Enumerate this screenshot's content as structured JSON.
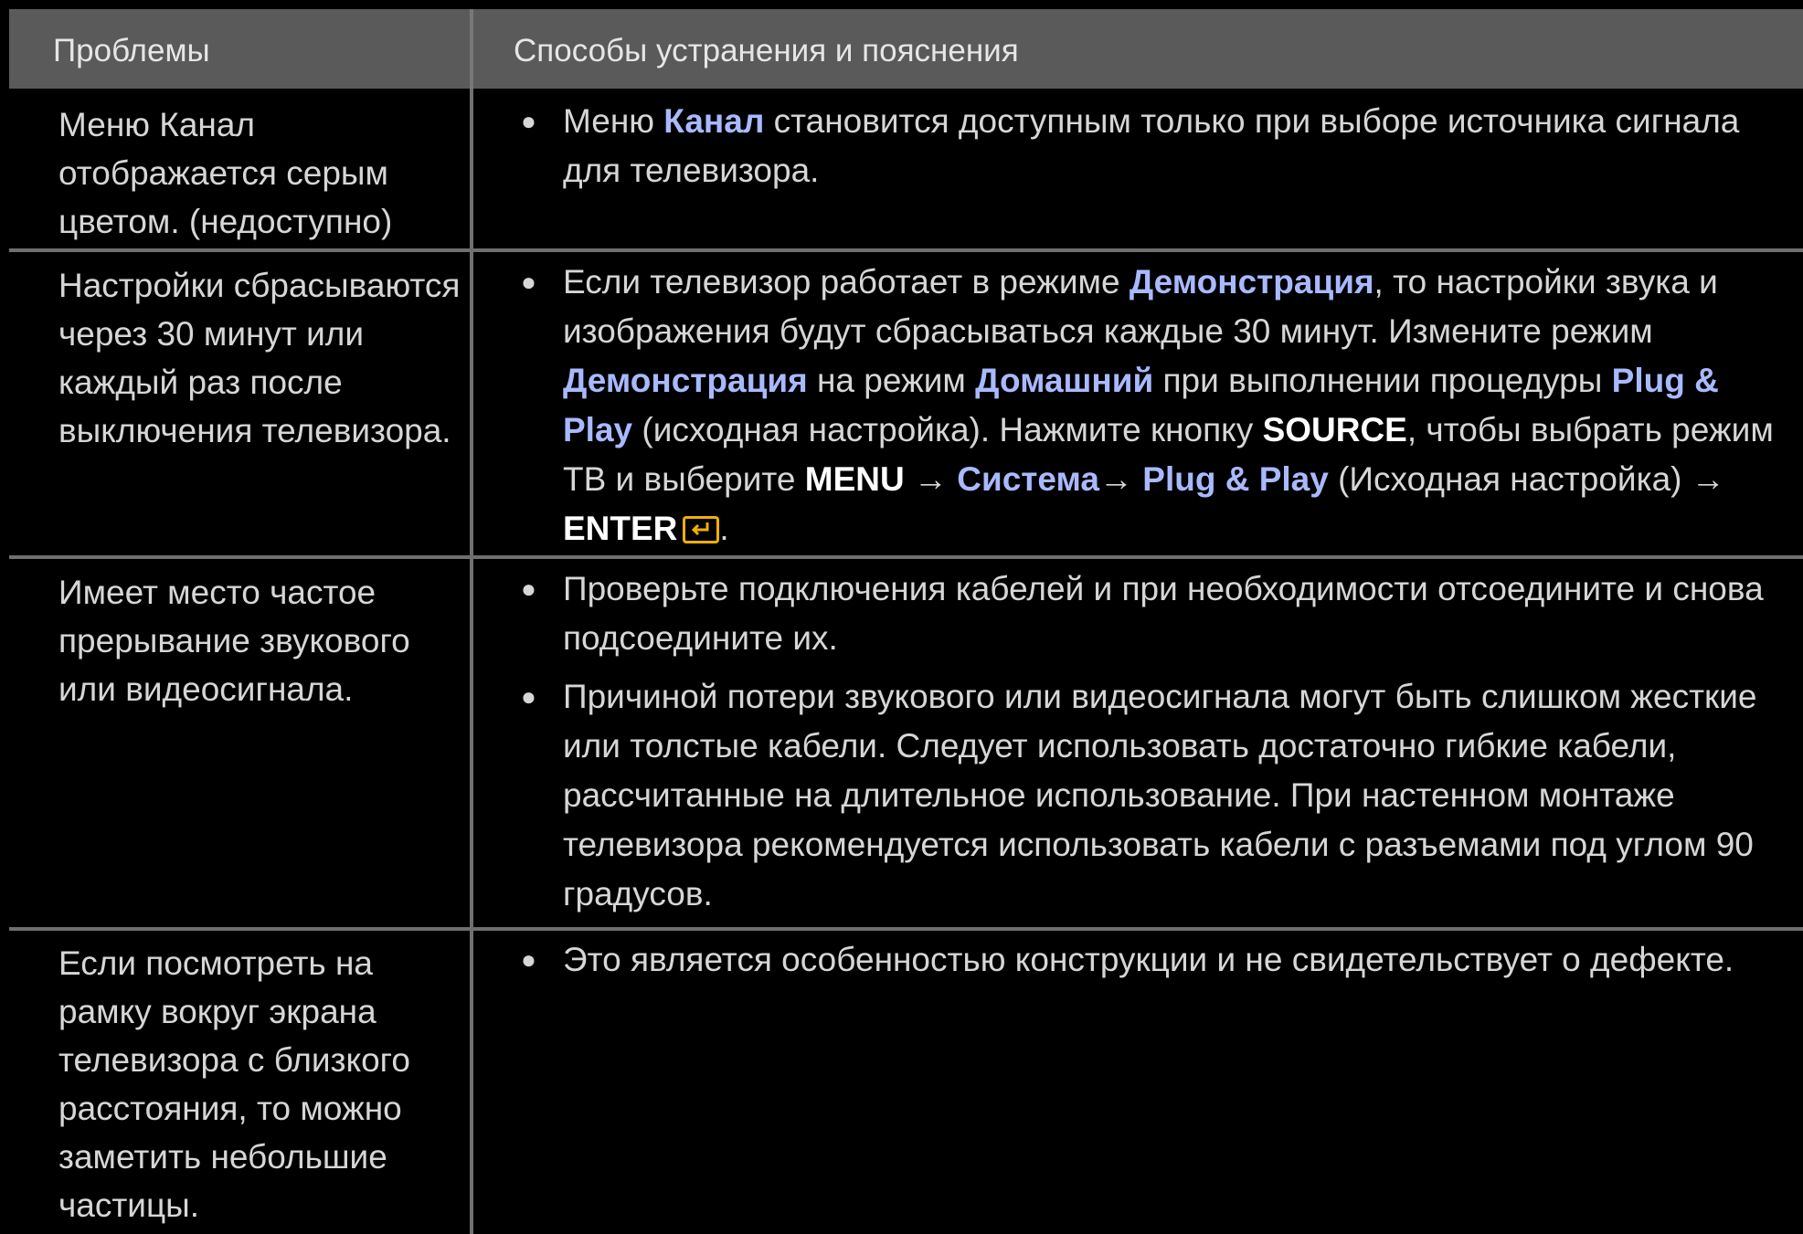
{
  "header": {
    "col_problems": "Проблемы",
    "col_solutions": "Способы устранения и пояснения"
  },
  "rows": [
    {
      "problem": "Меню Канал отображается серым цветом. (недоступно)",
      "solutions": [
        {
          "parts": [
            {
              "t": "Меню ",
              "s": "n"
            },
            {
              "t": "Канал",
              "s": "hl"
            },
            {
              "t": " становится доступным только при выборе источника сигнала для телевизора.",
              "s": "n"
            }
          ]
        }
      ]
    },
    {
      "problem": "Настройки сбрасываются через 30 минут или каждый раз после выключения телевизора.",
      "solutions": [
        {
          "parts": [
            {
              "t": "Если телевизор работает в режиме ",
              "s": "n"
            },
            {
              "t": "Демонстрация",
              "s": "hl"
            },
            {
              "t": ", то настройки звука и изображения будут сбрасываться каждые 30 минут. Измените режим ",
              "s": "n"
            },
            {
              "t": "Демонстрация",
              "s": "hl"
            },
            {
              "t": " на режим ",
              "s": "n"
            },
            {
              "t": "Домашний",
              "s": "hl"
            },
            {
              "t": " при выполнении процедуры ",
              "s": "n"
            },
            {
              "t": "Plug & Play",
              "s": "hl"
            },
            {
              "t": " (исходная настройка). Нажмите кнопку ",
              "s": "n"
            },
            {
              "t": "SOURCE",
              "s": "kw"
            },
            {
              "t": ", чтобы выбрать режим ТВ и выберите ",
              "s": "n"
            },
            {
              "t": "MENU",
              "s": "kw"
            },
            {
              "t": " → ",
              "s": "n"
            },
            {
              "t": "Система",
              "s": "hl"
            },
            {
              "t": "→ ",
              "s": "n"
            },
            {
              "t": "Plug & Play",
              "s": "hl"
            },
            {
              "t": " (Исходная настройка) → ",
              "s": "n"
            },
            {
              "t": "ENTER",
              "s": "kw"
            },
            {
              "t": "",
              "s": "enter-icon"
            },
            {
              "t": ".",
              "s": "n"
            }
          ]
        }
      ]
    },
    {
      "problem": "Имеет место частое прерывание звукового или видеосигнала.",
      "solutions": [
        {
          "parts": [
            {
              "t": "Проверьте подключения кабелей и при необходимости отсоедините и снова подсоедините их.",
              "s": "n"
            }
          ]
        },
        {
          "parts": [
            {
              "t": "Причиной потери звукового или видеосигнала могут быть слишком жесткие или толстые кабели. Следует использовать достаточно гибкие кабели, рассчитанные на длительное использование.  При настенном монтаже телевизора рекомендуется использовать кабели с разъемами под углом 90 градусов.",
              "s": "n"
            }
          ]
        }
      ]
    },
    {
      "problem": "Если посмотреть на рамку вокруг экрана телевизора с близкого расстояния, то можно заметить небольшие частицы.",
      "solutions": [
        {
          "parts": [
            {
              "t": "Это является особенностью конструкции и не свидетельствует о дефекте.",
              "s": "n"
            }
          ]
        }
      ]
    }
  ]
}
